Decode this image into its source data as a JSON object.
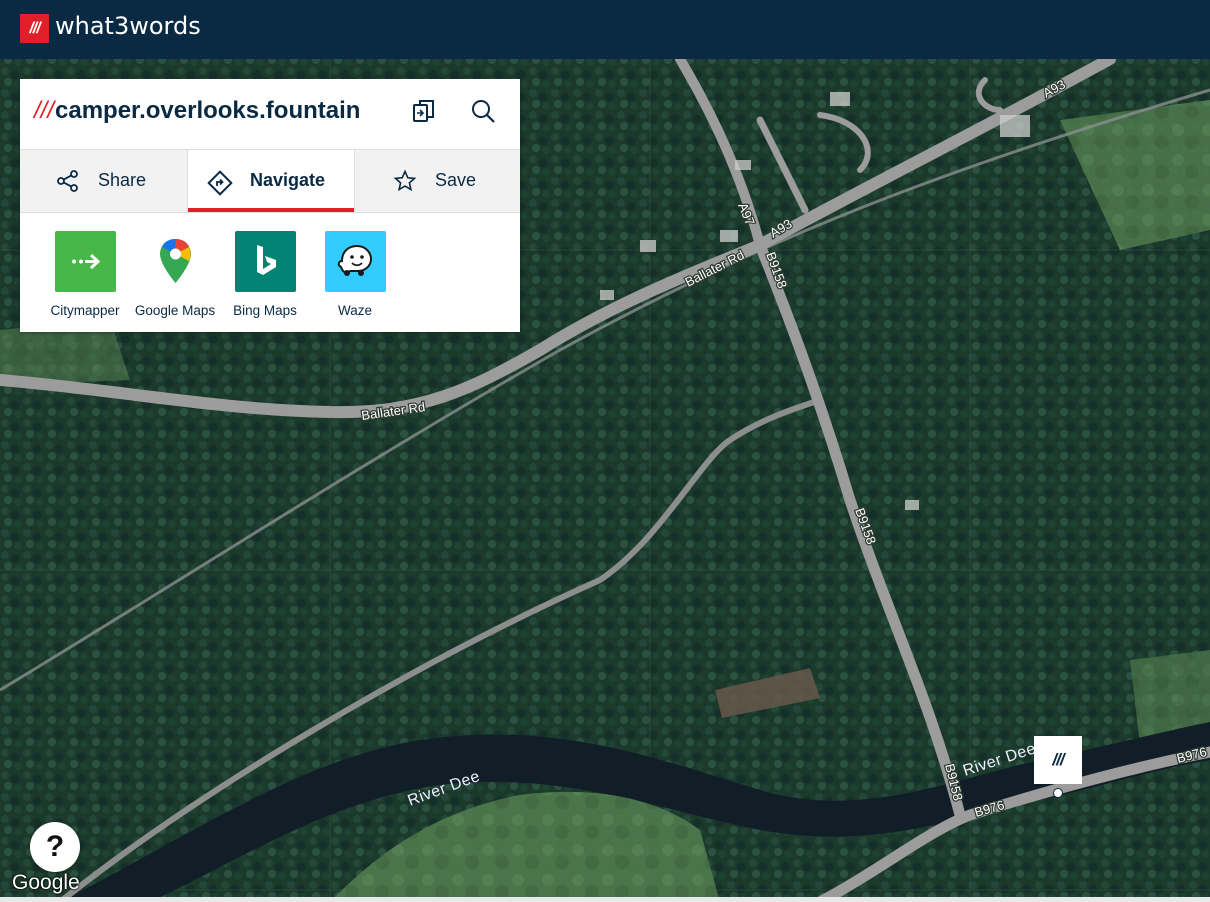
{
  "header": {
    "logo_mark": "///",
    "brand": "what3words"
  },
  "card": {
    "slashes": "///",
    "address": "camper.overlooks.fountain",
    "tabs": [
      {
        "label": "Share",
        "icon": "share-icon"
      },
      {
        "label": "Navigate",
        "icon": "directions-icon",
        "active": true
      },
      {
        "label": "Save",
        "icon": "star-icon"
      }
    ],
    "apps": [
      {
        "label": "Citymapper",
        "color": "#47b749"
      },
      {
        "label": "Google Maps",
        "color": "#ffffff"
      },
      {
        "label": "Bing Maps",
        "color": "#008373"
      },
      {
        "label": "Waze",
        "color": "#33ccff"
      }
    ]
  },
  "map": {
    "road_labels": {
      "a93_top": "A93",
      "a97": "A97",
      "a93_junction": "A93",
      "ballater_rd_1": "Ballater Rd",
      "b9158_top": "B9158",
      "ballater_rd_2": "Ballater Rd",
      "b9158_mid": "B9158",
      "b9158_bottom": "B9158",
      "b976_1": "B976",
      "b976_2": "B976"
    },
    "river_labels": {
      "left": "River Dee",
      "right": "River Dee"
    },
    "pin_mark": "///",
    "help": "?",
    "attribution": "Google"
  }
}
